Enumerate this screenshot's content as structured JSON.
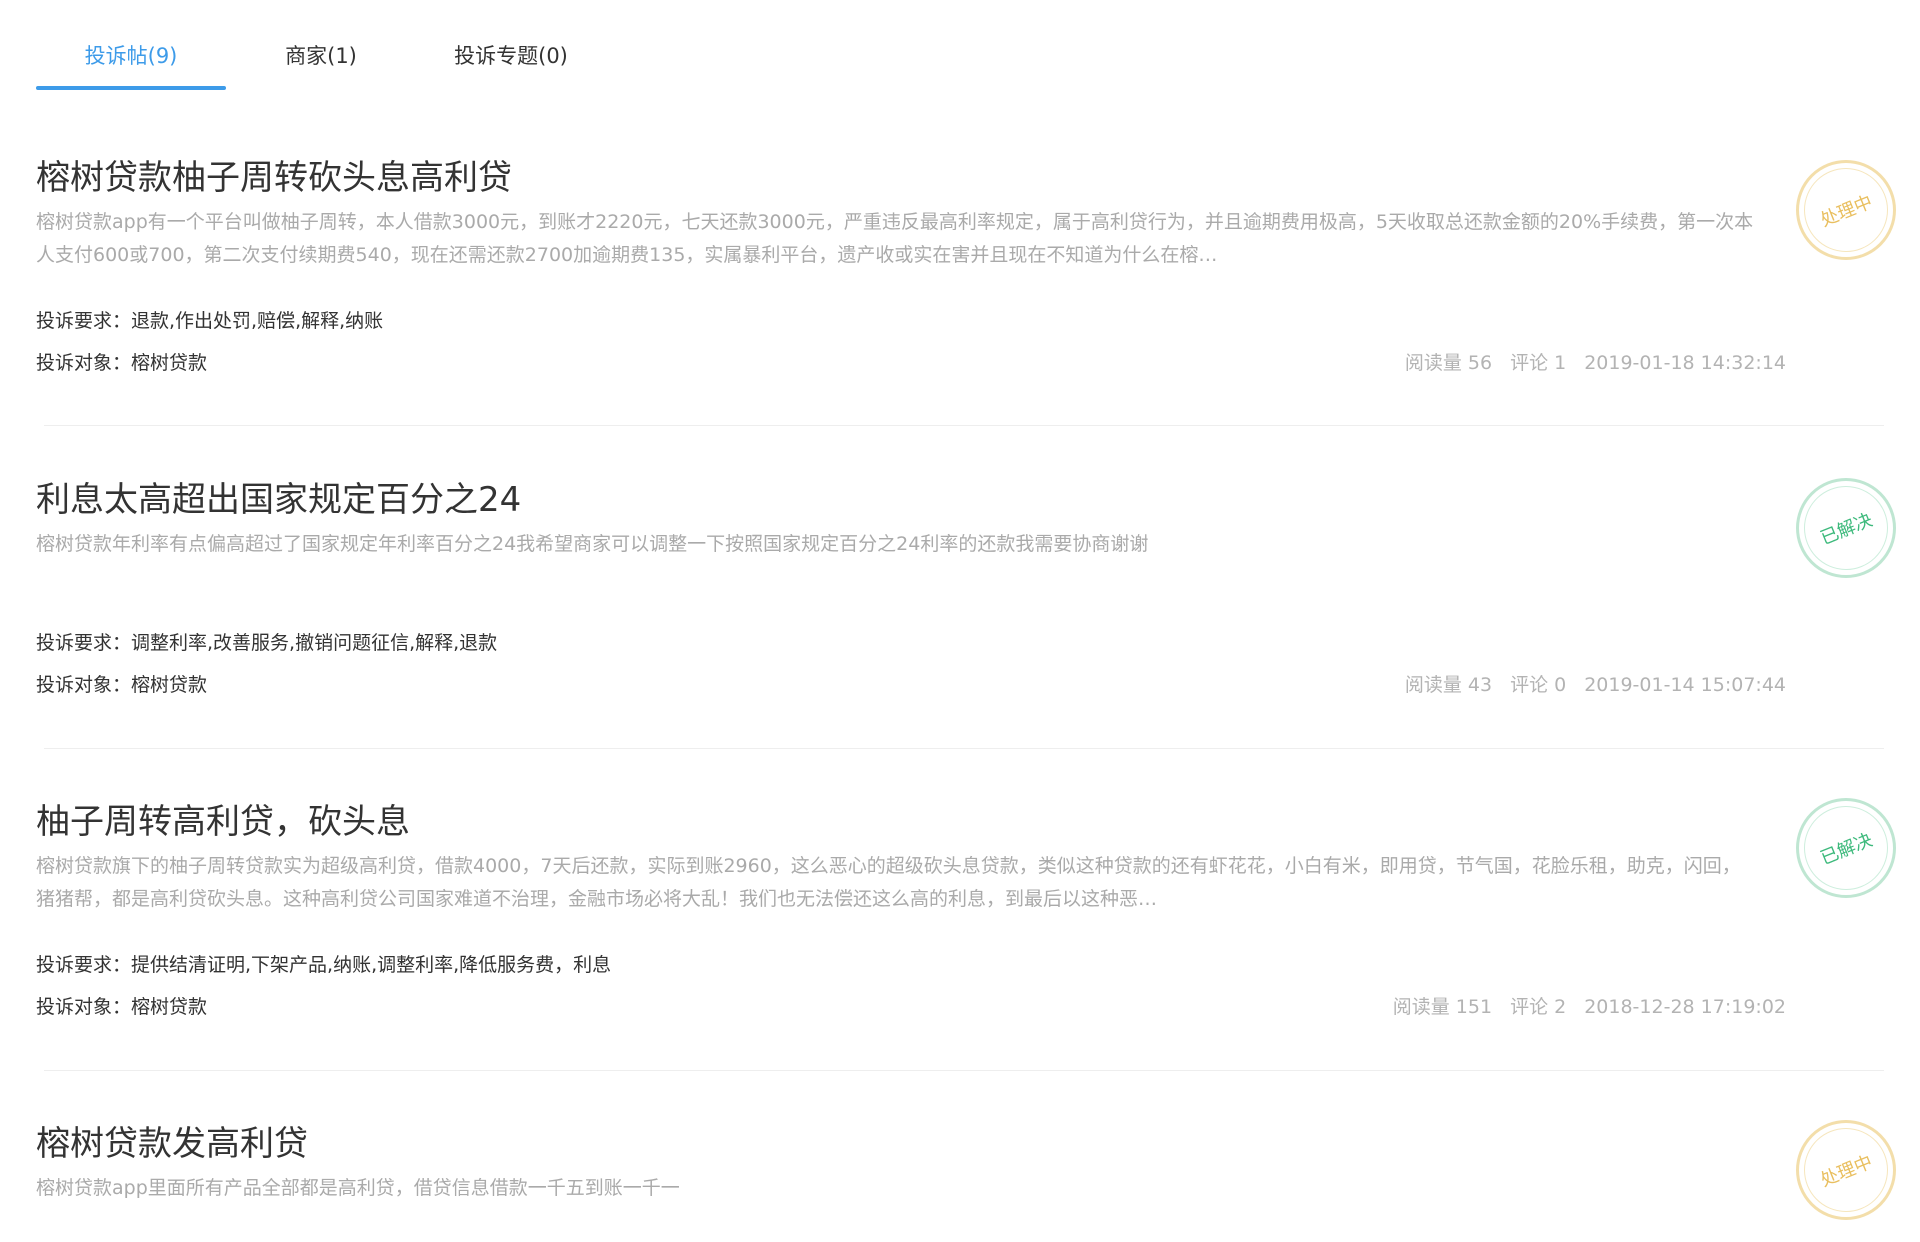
{
  "tabs": [
    {
      "label": "投诉帖(9)",
      "active": true
    },
    {
      "label": "商家(1)",
      "active": false
    },
    {
      "label": "投诉专题(0)",
      "active": false
    }
  ],
  "labels": {
    "demand": "投诉要求：",
    "target": "投诉对象："
  },
  "posts": [
    {
      "title": "榕树贷款柚子周转砍头息高利贷",
      "summary": "榕树贷款app有一个平台叫做柚子周转，本人借款3000元，到账才2220元，七天还款3000元，严重违反最高利率规定，属于高利贷行为，并且逾期费用极高，5天收取总还款金额的20%手续费，第一次本人支付600或700，第二次支付续期费540，现在还需还款2700加逾期费135，实属暴利平台，遗产收或实在害并且现在不知道为什么在榕…",
      "demand": "退款,作出处罚,赔偿,解释,纳账",
      "target": "榕树贷款",
      "views": "阅读量 56",
      "comments": "评论 1",
      "time": "2019-01-18 14:32:14",
      "status": "处理中",
      "status_type": "processing"
    },
    {
      "title": "利息太高超出国家规定百分之24",
      "summary": "榕树贷款年利率有点偏高超过了国家规定年利率百分之24我希望商家可以调整一下按照国家规定百分之24利率的还款我需要协商谢谢",
      "demand": "调整利率,改善服务,撤销问题征信,解释,退款",
      "target": "榕树贷款",
      "views": "阅读量 43",
      "comments": "评论 0",
      "time": "2019-01-14 15:07:44",
      "status": "已解决",
      "status_type": "resolved"
    },
    {
      "title": "柚子周转高利贷，砍头息",
      "summary": "榕树贷款旗下的柚子周转贷款实为超级高利贷，借款4000，7天后还款，实际到账2960，这么恶心的超级砍头息贷款，类似这种贷款的还有虾花花，小白有米，即用贷，节气国，花脸乐租，助克，闪回，猪猪帮，都是高利贷砍头息。这种高利贷公司国家难道不治理，金融市场必将大乱！我们也无法偿还这么高的利息，到最后以这种恶…",
      "demand": "提供结清证明,下架产品,纳账,调整利率,降低服务费，利息",
      "target": "榕树贷款",
      "views": "阅读量 151",
      "comments": "评论 2",
      "time": "2018-12-28 17:19:02",
      "status": "已解决",
      "status_type": "resolved"
    },
    {
      "title": "榕树贷款发高利贷",
      "summary": "榕树贷款app里面所有产品全部都是高利贷，借贷信息借款一千五到账一千一",
      "status": "处理中",
      "status_type": "processing"
    }
  ]
}
